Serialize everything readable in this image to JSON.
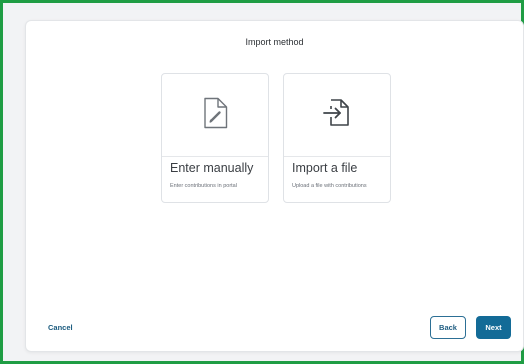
{
  "dialog": {
    "title": "Import method"
  },
  "options": [
    {
      "title": "Enter manually",
      "description": "Enter contributions in portal",
      "icon": "edit-document-icon"
    },
    {
      "title": "Import a file",
      "description": "Upload a file with contributions",
      "icon": "file-import-icon"
    }
  ],
  "footer": {
    "cancel_label": "Cancel",
    "back_label": "Back",
    "next_label": "Next"
  },
  "colors": {
    "frame_border": "#1f9d44",
    "primary": "#136b97",
    "link": "#1a5a7e"
  }
}
